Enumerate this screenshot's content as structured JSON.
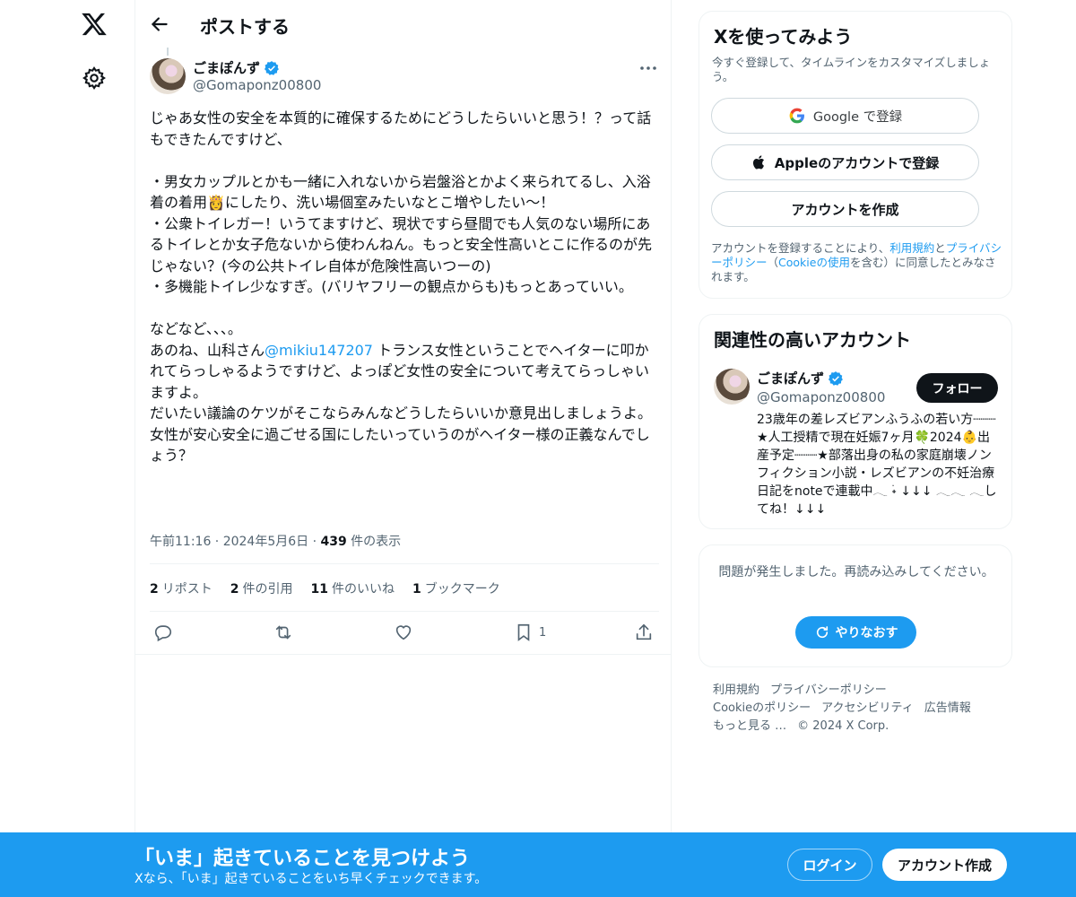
{
  "header": {
    "title": "ポストする"
  },
  "post": {
    "author_name": "ごまぽんず",
    "author_handle": "@Gomaponz00800",
    "text_part1": "じゃあ女性の安全を本質的に確保するためにどうしたらいいと思う！？って話もできたんですけど、\n\n・男女カップルとかも一緒に入れないから岩盤浴とかよく来られてるし、入浴着の着用👸にしたり、洗い場個室みたいなとこ増やしたい〜！\n・公衆トイレガー！いうてますけど、現状ですら昼間でも人気のない場所にあるトイレとか女子危ないから使わんねん。もっと安全性高いとこに作るのが先じゃない？(今の公共トイレ自体が危険性高いつーの)\n・多機能トイレ少なすぎ。(バリヤフリーの観点からも)もっとあっていい。\n\nなどなど、、、。\nあのね、山科さん",
    "mention": "@mikiu147207",
    "text_part2": " トランス女性ということでヘイターに叩かれてらっしゃるようですけど、よっぽど女性の安全について考えてらっしゃいますよ。\nだいたい議論のケツがそこならみんなどうしたらいいか意見出しましょうよ。\n女性が安心安全に過ごせる国にしたいっていうのがヘイター様の正義なんでしょう？",
    "time": "午前11:16 · 2024年5月6日 · ",
    "views_count": "439",
    "views_label": " 件の表示",
    "stats": [
      {
        "count": "2",
        "label": "リポスト"
      },
      {
        "count": "2",
        "label": "件の引用"
      },
      {
        "count": "11",
        "label": "件のいいね"
      },
      {
        "count": "1",
        "label": "ブックマーク"
      }
    ],
    "bookmark_count": "1"
  },
  "signup": {
    "title": "Xを使ってみよう",
    "subtitle": "今すぐ登録して、タイムラインをカスタマイズしましょう。",
    "google_label": "Google で登録",
    "apple_label": "Appleのアカウントで登録",
    "create_label": "アカウントを作成",
    "terms_prefix": "アカウントを登録することにより、",
    "terms_link": "利用規約",
    "terms_and": "と",
    "privacy_link": "プライバシーポリシー",
    "terms_paren_open": "（",
    "cookie_link": "Cookieの使用",
    "terms_suffix": "を含む）に同意したとみなされます。"
  },
  "related": {
    "title": "関連性の高いアカウント",
    "name": "ごまぽんず",
    "handle": "@Gomaponz00800",
    "follow_label": "フォロー",
    "bio": "23歳年の差レズビアンふうふの若い方┈┈┈★人工授精で現在妊娠7ヶ月🍀2024👶出産予定┈┈┈★部落出身の私の家庭崩壊ノンフィクション小説・レズビアンの不妊治療日記をnoteで連載中𓂃 ࣪˖ ↓↓↓ 𓂃𓂃 𓂃してね！↓↓↓"
  },
  "error": {
    "message": "問題が発生しました。再読み込みしてください。",
    "retry_label": "やりなおす"
  },
  "footer": {
    "links": [
      "利用規約",
      "プライバシーポリシー",
      "Cookieのポリシー",
      "アクセシビリティ",
      "広告情報",
      "もっと見る …"
    ],
    "copyright": "© 2024 X Corp."
  },
  "banner": {
    "title": "「いま」起きていることを見つけよう",
    "subtitle": "Xなら、「いま」起きていることをいち早くチェックできます。",
    "login_label": "ログイン",
    "create_label": "アカウント作成"
  },
  "colors": {
    "accent": "#1d9bf0",
    "text": "#0f1419",
    "muted": "#536471"
  }
}
